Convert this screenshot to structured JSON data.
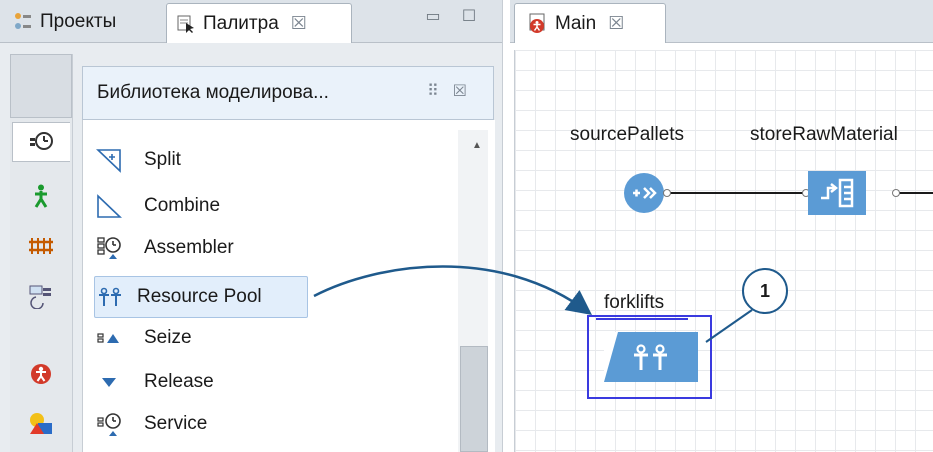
{
  "tabs": {
    "projects": "Проекты",
    "palette": "Палитра",
    "main": "Main"
  },
  "palette": {
    "library_title": "Библиотека моделирова...",
    "items": [
      {
        "label": "Split",
        "icon": "split-icon"
      },
      {
        "label": "Combine",
        "icon": "combine-icon"
      },
      {
        "label": "Assembler",
        "icon": "assembler-icon"
      },
      {
        "label": "Resource Pool",
        "icon": "resource-pool-icon",
        "selected": true
      },
      {
        "label": "Seize",
        "icon": "seize-icon"
      },
      {
        "label": "Release",
        "icon": "release-icon"
      },
      {
        "label": "Service",
        "icon": "service-icon"
      }
    ],
    "rail_icons": [
      "process-modeling-icon",
      "pedestrian-icon",
      "rail-icon",
      "fluid-icon",
      "agent-icon",
      "shapes-icon"
    ]
  },
  "canvas": {
    "blocks": {
      "source": "sourcePallets",
      "store": "storeRawMaterial",
      "pool": "forklifts"
    },
    "callout": "1"
  },
  "colors": {
    "block_fill": "#5b9bd5",
    "selection": "#3a3adf",
    "arrow": "#1f5a8c"
  }
}
